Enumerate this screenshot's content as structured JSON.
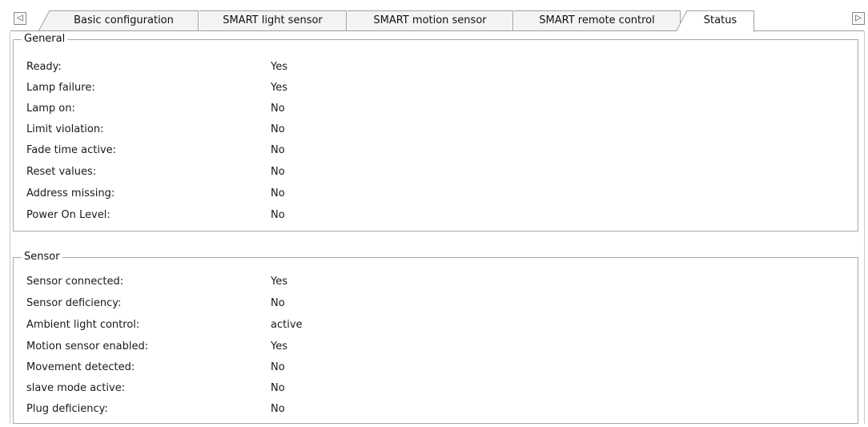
{
  "tabs": [
    {
      "label": "Basic configuration",
      "active": false
    },
    {
      "label": "SMART light sensor",
      "active": false
    },
    {
      "label": "SMART motion sensor",
      "active": false
    },
    {
      "label": "SMART remote control",
      "active": false
    },
    {
      "label": "Status",
      "active": true
    }
  ],
  "scroll_buttons": {
    "left_icon": "◁",
    "right_icon": "▷"
  },
  "general": {
    "title": "General",
    "rows": [
      {
        "label": "Ready:",
        "value": "Yes"
      },
      {
        "label": "Lamp failure:",
        "value": "Yes"
      },
      {
        "label": "Lamp on:",
        "value": "No"
      },
      {
        "label": "Limit violation:",
        "value": "No"
      },
      {
        "label": "Fade time active:",
        "value": "No"
      },
      {
        "label": "Reset values:",
        "value": "No"
      },
      {
        "label": "Address missing:",
        "value": "No"
      },
      {
        "label": "Power On Level:",
        "value": "No"
      }
    ]
  },
  "sensor": {
    "title": "Sensor",
    "rows": [
      {
        "label": "Sensor connected:",
        "value": "Yes"
      },
      {
        "label": "Sensor deficiency:",
        "value": "No"
      },
      {
        "label": "Ambient light control:",
        "value": "active"
      },
      {
        "label": "Motion sensor enabled:",
        "value": "Yes"
      },
      {
        "label": "Movement detected:",
        "value": "No"
      },
      {
        "label": "slave mode active:",
        "value": "No"
      },
      {
        "label": "Plug deficiency:",
        "value": "No"
      }
    ]
  }
}
